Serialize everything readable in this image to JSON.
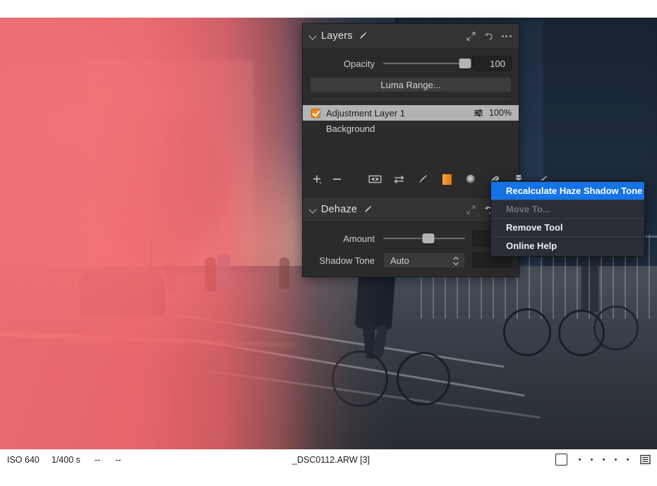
{
  "app": {
    "accent_orange": "#e8892a",
    "accent_blue": "#1473e6",
    "panel_bg": "#2b2b2b"
  },
  "layers_panel": {
    "title": "Layers",
    "collapse_icon": "chevron-down-icon",
    "brush_icon": "brush-icon",
    "expand_icon": "expand-arrows-icon",
    "reset_icon": "reset-arrow-icon",
    "more_icon": "more-options-icon",
    "opacity": {
      "label": "Opacity",
      "value": "100",
      "slider_percent": 100
    },
    "luma_range_button": "Luma Range...",
    "layers": [
      {
        "name": "Adjustment Layer 1",
        "checked": true,
        "opacity": "100%",
        "selected": true,
        "settings_icon": "sliders-icon"
      },
      {
        "name": "Background",
        "checked": false,
        "opacity": "",
        "selected": false
      }
    ],
    "toolbar": [
      {
        "name": "add-layer-button",
        "icon": "plus-icon"
      },
      {
        "name": "remove-layer-button",
        "icon": "minus-icon"
      },
      {
        "name": "show-mask-button",
        "icon": "eye-icon"
      },
      {
        "name": "invert-mask-button",
        "icon": "transfer-arrows-icon"
      },
      {
        "name": "brush-tool-button",
        "icon": "brush-icon"
      },
      {
        "name": "gradient-tool-button",
        "icon": "gradient-swatch-icon"
      },
      {
        "name": "radial-mask-button",
        "icon": "radial-gradient-icon"
      },
      {
        "name": "heal-tool-button",
        "icon": "healing-patch-icon"
      },
      {
        "name": "clone-tool-button",
        "icon": "clone-stamp-icon"
      },
      {
        "name": "erase-tool-button",
        "icon": "eraser-icon"
      }
    ]
  },
  "dehaze_panel": {
    "title": "Dehaze",
    "collapse_icon": "chevron-down-icon",
    "brush_icon": "brush-icon",
    "expand_icon": "expand-arrows-icon",
    "reset_icon": "reset-arrow-icon",
    "more_icon": "more-options-icon",
    "amount": {
      "label": "Amount",
      "slider_percent": 55
    },
    "shadow_tone": {
      "label": "Shadow Tone",
      "value": "Auto"
    }
  },
  "context_menu": {
    "items": [
      {
        "label": "Recalculate Haze Shadow Tone",
        "state": "highlighted"
      },
      {
        "label": "Move To...",
        "state": "disabled"
      },
      {
        "label": "Remove Tool",
        "state": "normal"
      },
      {
        "label": "Online Help",
        "state": "normal"
      }
    ]
  },
  "status_bar": {
    "iso": "ISO 640",
    "shutter": "1/400 s",
    "aperture": "--",
    "focal": "--",
    "filename": "_DSC0112.ARW [3]",
    "color_tag_icon": "color-tag-square-icon",
    "rating_dots": 5,
    "list_icon": "list-view-icon"
  }
}
